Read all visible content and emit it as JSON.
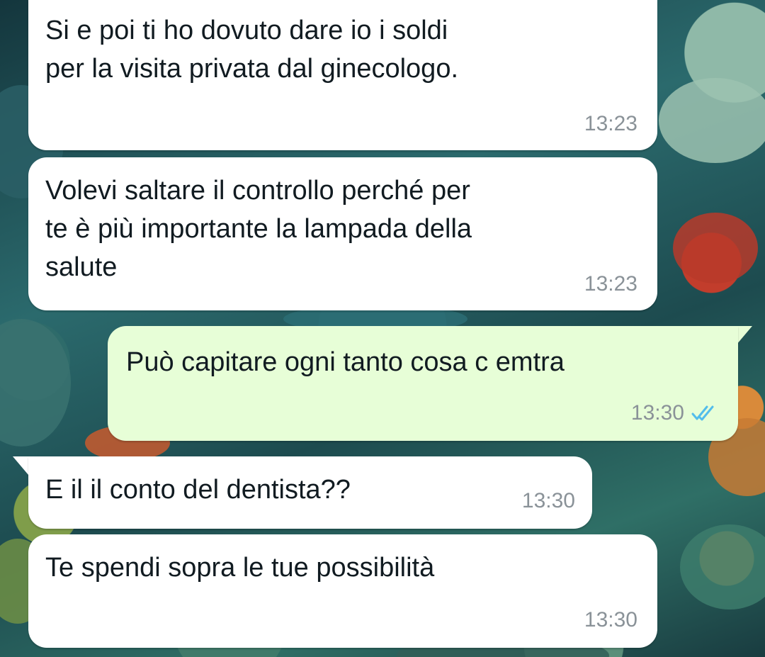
{
  "chat": {
    "messages": [
      {
        "direction": "incoming",
        "text": "Si e poi ti ho dovuto dare io i soldi\nper la visita privata dal ginecologo.",
        "time": "13:23"
      },
      {
        "direction": "incoming",
        "text": "Volevi saltare il controllo perché per\nte è più importante la lampada della\nsalute",
        "time": "13:23"
      },
      {
        "direction": "outgoing",
        "text": "Può capitare ogni tanto cosa c emtra",
        "time": "13:30",
        "status_icon": "double-check-read-icon"
      },
      {
        "direction": "incoming",
        "text": "E il il conto del dentista??",
        "time": "13:30"
      },
      {
        "direction": "incoming",
        "text": "Te spendi sopra le tue possibilità",
        "time": "13:30"
      }
    ]
  },
  "colors": {
    "incoming_bubble": "#ffffff",
    "outgoing_bubble": "#e7fed7",
    "timestamp": "#8a9298",
    "read_ticks": "#53bdeb"
  }
}
